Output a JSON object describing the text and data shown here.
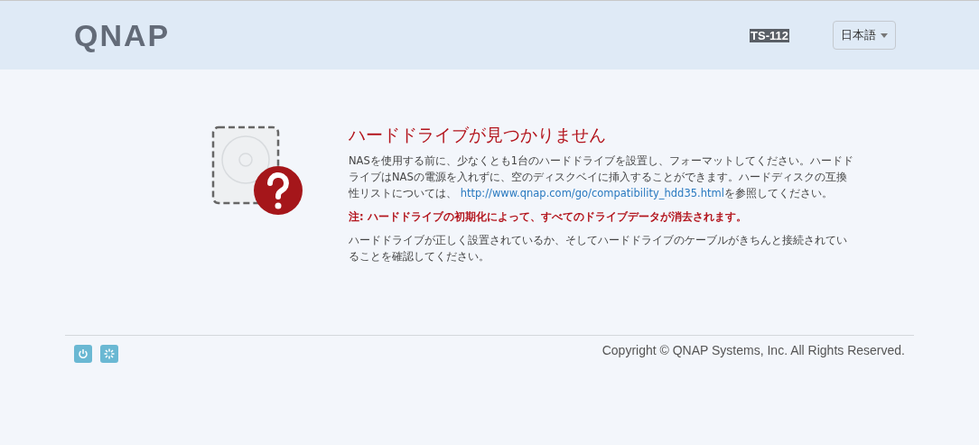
{
  "header": {
    "logo": "QNAP",
    "model": "TS-112",
    "language": "日本語"
  },
  "message": {
    "title": "ハードドライブが見つかりません",
    "intro": {
      "before": "NASを使用する前に、少なくとも1台のハードドライブを設置し、フォーマットしてください。ハードドライブはNASの電源を入れずに、空のディスクベイに挿入することができます。ハードディスクの互換性リストについては、 ",
      "link": "http://www.qnap.com/go/compatibility_hdd35.html",
      "after": "を参照してください。"
    },
    "warning": "注: ハードドライブの初期化によって、すべてのドライブデータが消去されます。",
    "note": "ハードドライブが正しく設置されているか、そしてハードドライブのケーブルがきちんと接続されていることを確認してください。"
  },
  "footer": {
    "copyright": "Copyright © QNAP Systems, Inc. All Rights Reserved."
  }
}
